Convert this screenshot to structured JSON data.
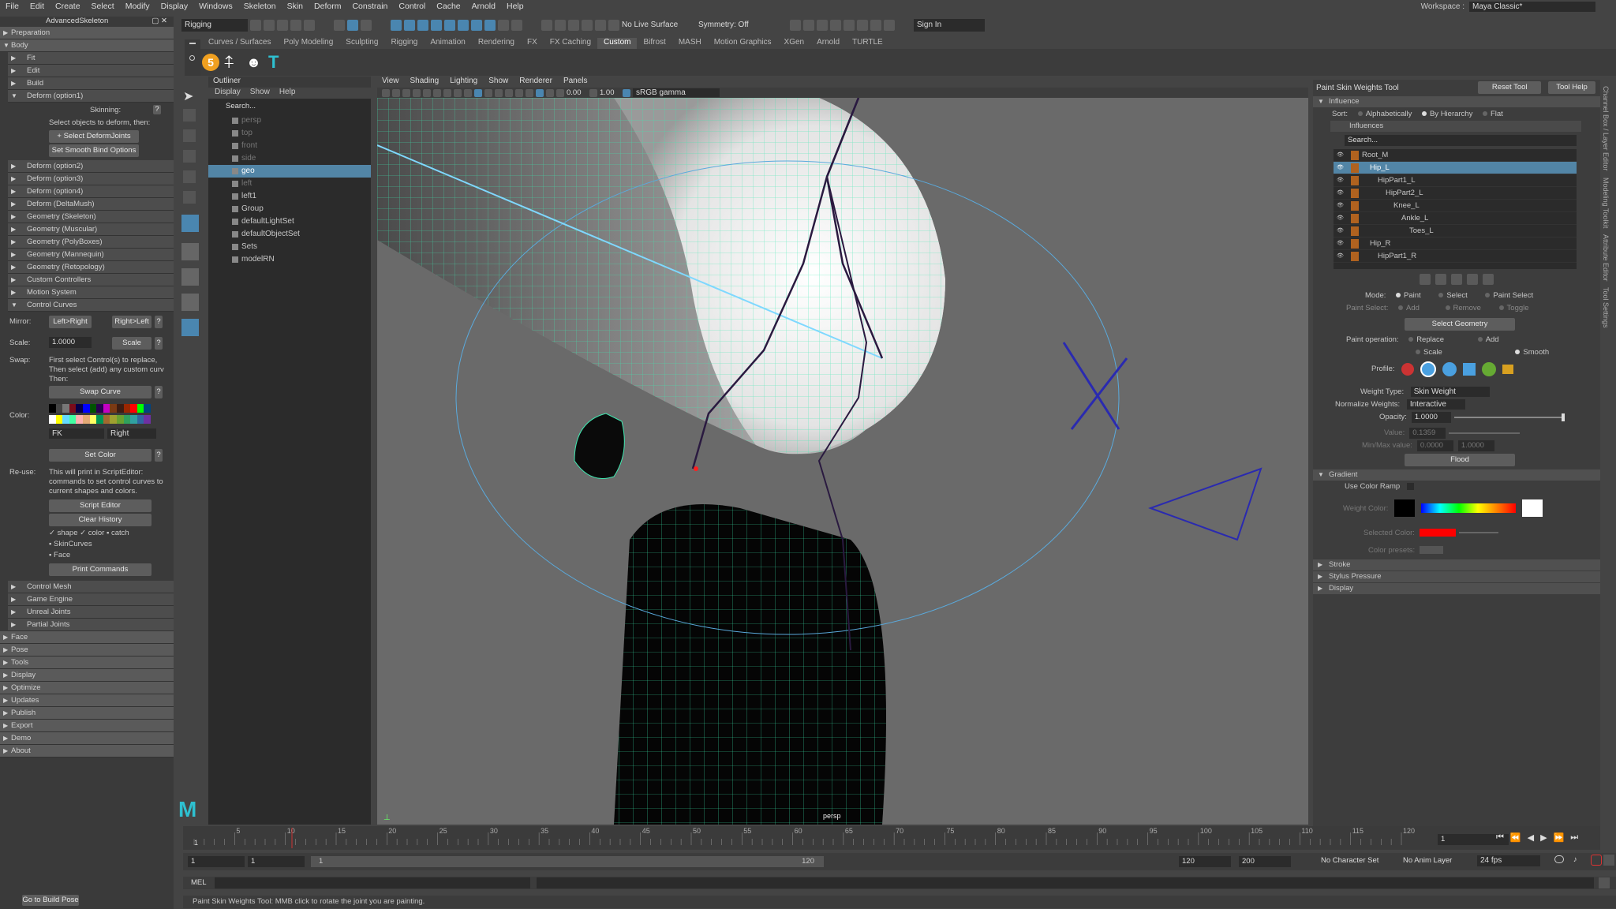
{
  "menu": [
    "File",
    "Edit",
    "Create",
    "Select",
    "Modify",
    "Display",
    "Windows",
    "Skeleton",
    "Skin",
    "Deform",
    "Constrain",
    "Control",
    "Cache",
    "Arnold",
    "Help"
  ],
  "workspace": {
    "label": "Workspace :",
    "value": "Maya Classic*"
  },
  "toolbar": {
    "menuset": "Rigging",
    "live": "No Live Surface",
    "symmetry": "Symmetry: Off",
    "signin": "Sign In"
  },
  "shelf_tabs": [
    "Curves / Surfaces",
    "Poly Modeling",
    "Sculpting",
    "Rigging",
    "Animation",
    "Rendering",
    "FX",
    "FX Caching",
    "Custom",
    "Bifrost",
    "MASH",
    "Motion Graphics",
    "XGen",
    "Arnold",
    "TURTLE"
  ],
  "active_shelf": "Custom",
  "left": {
    "title": "AdvancedSkeleton",
    "top_sections": [
      "Preparation",
      "Body"
    ],
    "body_items": [
      "Fit",
      "Edit",
      "Build"
    ],
    "deform_open": "Deform      (option1)",
    "skinning_label": "Skinning:",
    "select_hint": "Select objects to deform, then:",
    "btn_select_deform": "+ Select DeformJoints",
    "btn_smooth_bind": "Set Smooth Bind Options",
    "more_items": [
      "Deform      (option2)",
      "Deform      (option3)",
      "Deform      (option4)",
      "Deform      (DeltaMush)",
      "Geometry (Skeleton)",
      "Geometry (Muscular)",
      "Geometry (PolyBoxes)",
      "Geometry (Mannequin)",
      "Geometry (Retopology)",
      "Custom Controllers",
      "Motion System"
    ],
    "control_curves": "Control Curves",
    "mirror_label": "Mirror:",
    "mirror_lr": "Left>Right",
    "mirror_rl": "Right>Left",
    "scale_label": "Scale:",
    "scale_value": "1.0000",
    "scale_btn": "Scale",
    "swap_label": "Swap:",
    "swap_text": "First select Control(s) to replace, Then select (add) any custom curv Then:",
    "swap_btn": "Swap Curve",
    "color_label": "Color:",
    "color_fk": "FK",
    "color_side": "Right",
    "set_color": "Set Color",
    "reuse_label": "Re-use:",
    "reuse_text": "This will print in ScriptEditor: commands to set control curves to current shapes and colors.",
    "script_editor": "Script Editor",
    "clear_history": "Clear History",
    "chk_shape": "shape",
    "chk_color": "color",
    "chk_catch": "catch",
    "chk_skin": "SkinCurves",
    "chk_face": "Face",
    "print_cmds": "Print Commands",
    "tail_sub": [
      "Control Mesh",
      "Game Engine",
      "Unreal Joints",
      "Partial Joints"
    ],
    "tail": [
      "Face",
      "Pose",
      "Tools",
      "Display",
      "Optimize",
      "Updates",
      "Publish",
      "Export",
      "Demo",
      "About"
    ],
    "build_pose": "Go to Build Pose",
    "swatches": [
      "#000000",
      "#444444",
      "#777777",
      "#7a0b1a",
      "#06004a",
      "#0000ff",
      "#005300",
      "#2a0050",
      "#c400c4",
      "#7c3a14",
      "#3e1d12",
      "#9b2600",
      "#ff0000",
      "#00ff00",
      "#00447f",
      "#ffffff",
      "#ffff00",
      "#63dbff",
      "#43ffa3",
      "#ffb0b0",
      "#e4aa76",
      "#ffff62",
      "#009654",
      "#a1692f",
      "#9fa130",
      "#68a130",
      "#30a15d",
      "#30a1a1",
      "#3066a1",
      "#6f30a1"
    ]
  },
  "outliner": {
    "title": "Outliner",
    "menu": [
      "Display",
      "Show",
      "Help"
    ],
    "search": "Search...",
    "items": [
      {
        "n": "persp",
        "dim": true
      },
      {
        "n": "top",
        "dim": true
      },
      {
        "n": "front",
        "dim": true
      },
      {
        "n": "side",
        "dim": true
      },
      {
        "n": "geo",
        "sel": true
      },
      {
        "n": "left",
        "dim": true
      },
      {
        "n": "left1"
      },
      {
        "n": "Group"
      },
      {
        "n": "defaultLightSet"
      },
      {
        "n": "defaultObjectSet"
      },
      {
        "n": "Sets"
      },
      {
        "n": "modelRN"
      }
    ]
  },
  "viewport": {
    "menu": [
      "View",
      "Shading",
      "Lighting",
      "Show",
      "Renderer",
      "Panels"
    ],
    "exposure": "0.00",
    "gamma": "1.00",
    "colorspace": "sRGB gamma",
    "camera": "persp"
  },
  "tool": {
    "title": "Paint Skin Weights Tool",
    "reset": "Reset Tool",
    "help": "Tool Help",
    "influence": "Influence",
    "sort_label": "Sort:",
    "sort": [
      "Alphabetically",
      "By Hierarchy",
      "Flat"
    ],
    "influences": "Influences",
    "search": "Search...",
    "joints": [
      "Root_M",
      "Hip_L",
      "HipPart1_L",
      "HipPart2_L",
      "Knee_L",
      "Ankle_L",
      "Toes_L",
      "Hip_R",
      "HipPart1_R"
    ],
    "mode_label": "Mode:",
    "modes": [
      "Paint",
      "Select",
      "Paint Select"
    ],
    "paint_select_label": "Paint Select:",
    "paint_select": [
      "Add",
      "Remove",
      "Toggle"
    ],
    "select_geometry": "Select Geometry",
    "paint_op_label": "Paint operation:",
    "paint_ops": [
      "Replace",
      "Add",
      "Scale",
      "Smooth"
    ],
    "profile_label": "Profile:",
    "weight_type_label": "Weight Type:",
    "weight_type": "Skin Weight",
    "normalize_label": "Normalize Weights:",
    "normalize": "Interactive",
    "opacity_label": "Opacity:",
    "opacity": "1.0000",
    "value_label": "Value:",
    "value": "0.1359",
    "minmax_label": "Min/Max value:",
    "min": "0.0000",
    "max": "1.0000",
    "flood": "Flood",
    "gradient": "Gradient",
    "use_ramp": "Use Color Ramp",
    "weight_color": "Weight Color:",
    "selected_color": "Selected Color:",
    "color_presets": "Color presets:",
    "sections": [
      "Stroke",
      "Stylus Pressure",
      "Display"
    ]
  },
  "side_tabs": [
    "Channel Box / Layer Editor",
    "Modeling Toolkit",
    "Attribute Editor",
    "Tool Settings"
  ],
  "timeline": {
    "ticks": [
      "5",
      "10",
      "15",
      "20",
      "25",
      "30",
      "35",
      "40",
      "45",
      "50",
      "55",
      "60",
      "65",
      "70",
      "75",
      "80",
      "85",
      "90",
      "95",
      "100",
      "105",
      "110",
      "115",
      "120"
    ],
    "first": "1",
    "current": "1"
  },
  "range": {
    "start": "1",
    "start2": "1",
    "slider_start": "1",
    "slider_end": "120",
    "end": "120",
    "end2": "200",
    "char_set": "No Character Set",
    "anim_layer": "No Anim Layer",
    "fps": "24 fps"
  },
  "cmd": {
    "label": "MEL"
  },
  "help_line": "Paint Skin Weights Tool: MMB click to rotate the joint you are painting."
}
